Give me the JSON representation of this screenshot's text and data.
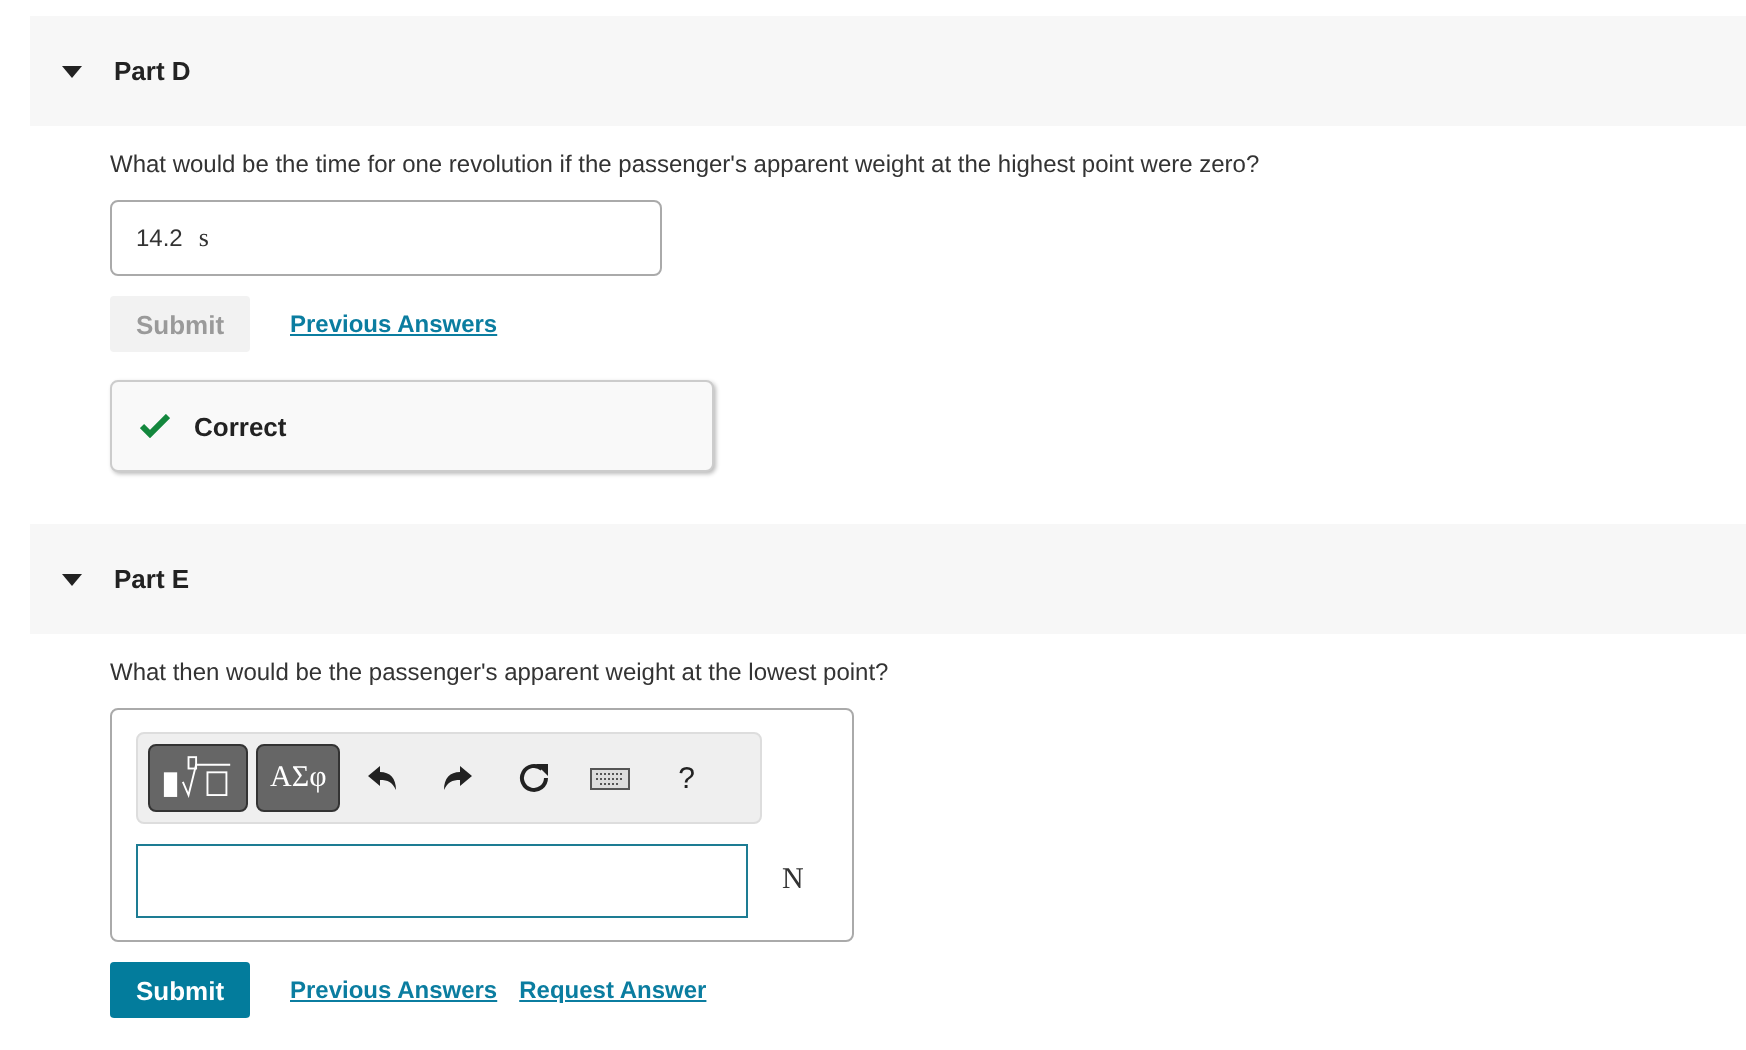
{
  "parts": [
    {
      "kind": "answered",
      "title": "Part D",
      "expanded": true,
      "question": "What would be the time for one revolution if the passenger's apparent weight at the highest point were zero?",
      "answer": "14.2",
      "unit": "s",
      "submit": {
        "label": "Submit",
        "disabled": true
      },
      "links": [
        "Previous Answers"
      ],
      "feedback": {
        "kind": "correct",
        "text": "Correct"
      }
    },
    {
      "kind": "editor",
      "title": "Part E",
      "expanded": true,
      "question": "What then would be the passenger's apparent weight at the lowest point?",
      "toolbar": {
        "symbols": "ΑΣφ",
        "help": "?"
      },
      "unit": "N",
      "submit": {
        "label": "Submit",
        "disabled": false
      },
      "links": [
        "Previous Answers",
        "Request Answer"
      ]
    }
  ]
}
